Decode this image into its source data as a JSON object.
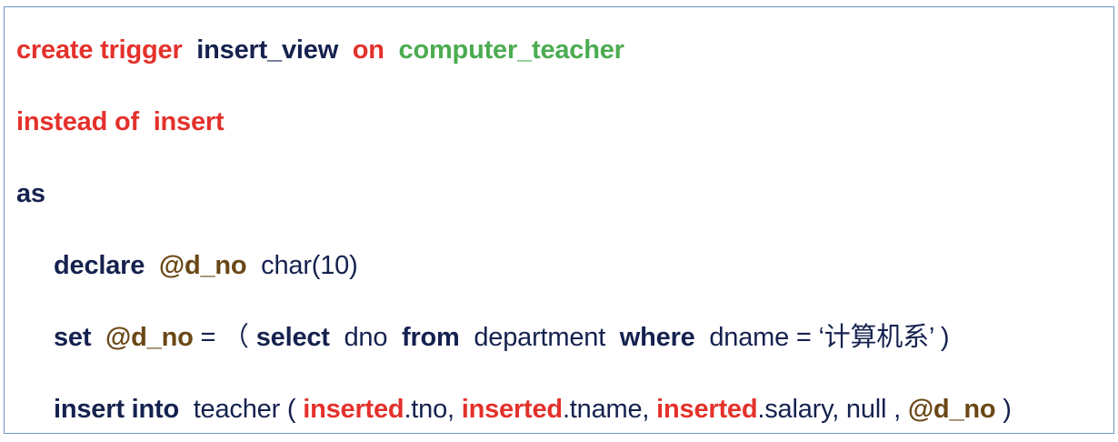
{
  "colors": {
    "keyword_red": "#e4312b",
    "keyword_navy": "#15224f",
    "identifier_green": "#4bac51",
    "variable_brown": "#6a4716",
    "border_blue": "#6f95c9"
  },
  "code": {
    "line1": {
      "create_trigger": "create trigger",
      "trigger_name": "insert_view",
      "on": "on",
      "view_name": "computer_teacher"
    },
    "line2": {
      "instead_of": "instead of",
      "insert": "insert"
    },
    "line3": {
      "as": "as"
    },
    "line4": {
      "declare": "declare",
      "var": "@d_no",
      "type": "char(10)"
    },
    "line5": {
      "set": "set",
      "var": "@d_no",
      "eq_paren": "= （",
      "select": "select",
      "col": "dno",
      "from": "from",
      "table": "department",
      "where": "where",
      "condition": "dname = ‘计算机系’ )"
    },
    "line6": {
      "insert_into": "insert into",
      "table_open": "teacher (",
      "inserted1": "inserted",
      "field1": ".tno,",
      "inserted2": "inserted",
      "field2": ".tname,",
      "inserted3": "inserted",
      "field3": ".salary, null ,",
      "var": "@d_no",
      "close": ")"
    }
  }
}
